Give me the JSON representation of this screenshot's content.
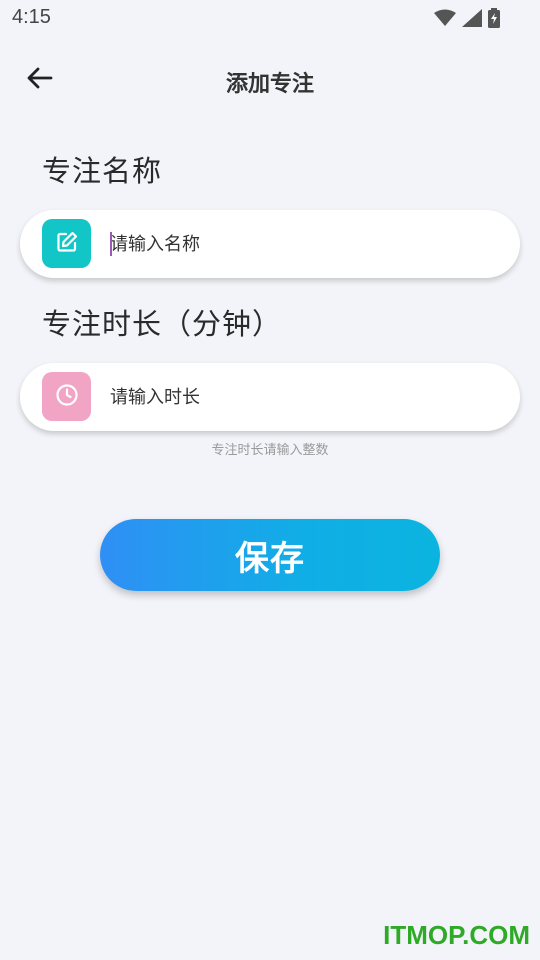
{
  "status_bar": {
    "time": "4:15",
    "icons": [
      "wifi-icon",
      "signal-icon",
      "battery-icon"
    ]
  },
  "header": {
    "title": "添加专注",
    "back_icon": "arrow-left-icon"
  },
  "form": {
    "name": {
      "label": "专注名称",
      "placeholder": "请输入名称",
      "value": "",
      "icon": "edit-icon",
      "icon_color": "#12c5c7"
    },
    "duration": {
      "label": "专注时长（分钟）",
      "placeholder": "请输入时长",
      "value": "",
      "icon": "clock-icon",
      "icon_color": "#f2a4c4",
      "hint": "专注时长请输入整数"
    }
  },
  "actions": {
    "save_label": "保存",
    "accent_start": "#2f8ff5",
    "accent_end": "#0bb4df"
  },
  "watermark": "ITMOP.COM"
}
